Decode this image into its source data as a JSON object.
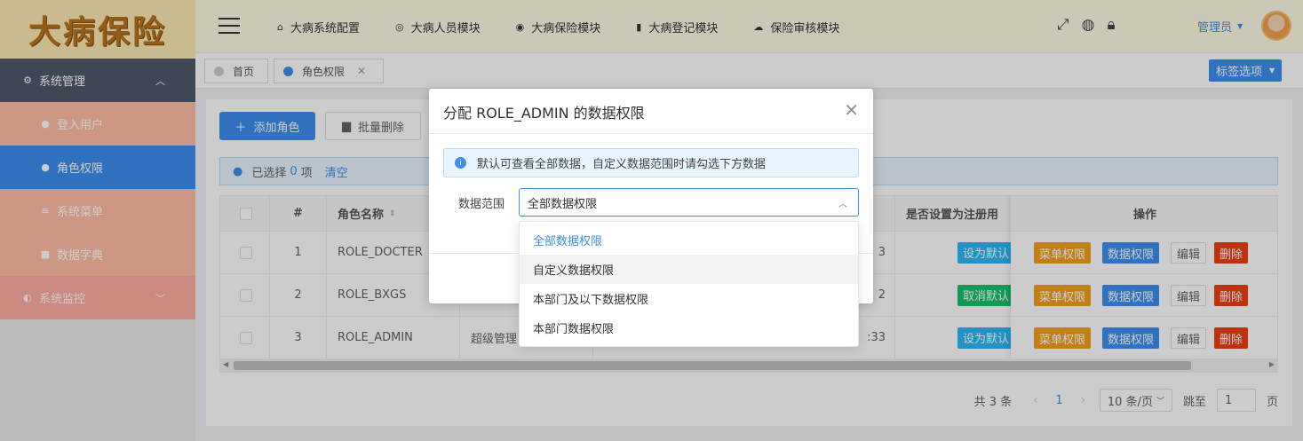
{
  "logo": {
    "text": "大病保险"
  },
  "sidebar": {
    "group": {
      "label": "系统管理",
      "icon": "gear-icon"
    },
    "items": [
      {
        "label": "登入用户",
        "icon": "user-icon"
      },
      {
        "label": "角色权限",
        "icon": "users-icon"
      },
      {
        "label": "系统菜单",
        "icon": "menu-icon"
      },
      {
        "label": "数据字典",
        "icon": "book-icon"
      }
    ],
    "monitor": {
      "label": "系统监控",
      "icon": "monitor-icon"
    }
  },
  "topnav": [
    {
      "label": "大病系统配置",
      "icon": "home-icon"
    },
    {
      "label": "大病人员模块",
      "icon": "settings-icon"
    },
    {
      "label": "大病保险模块",
      "icon": "disc-icon"
    },
    {
      "label": "大病登记模块",
      "icon": "book-icon"
    },
    {
      "label": "保险审核模块",
      "icon": "cloud-icon"
    }
  ],
  "user": {
    "name": "管理员"
  },
  "tags": {
    "home": "首页",
    "current": "角色权限",
    "options": "标签选项"
  },
  "toolbar": {
    "add": "添加角色",
    "batch_delete": "批量删除"
  },
  "selection": {
    "prefix": "已选择",
    "count": "0",
    "suffix": "项",
    "clear": "清空"
  },
  "table": {
    "headers": {
      "index": "#",
      "name": "角色名称",
      "register": "是否设置为注册用",
      "actions": "操作"
    },
    "rows": [
      {
        "index": "1",
        "name": "ROLE_DOCTER",
        "desc": "",
        "time": "3",
        "reg_btn": "设为默认",
        "reg_color": "#2db7f5"
      },
      {
        "index": "2",
        "name": "ROLE_BXGS",
        "desc": "",
        "time": "2",
        "reg_btn": "取消默认",
        "reg_color": "#19be6b"
      },
      {
        "index": "3",
        "name": "ROLE_ADMIN",
        "desc": "超级管理",
        "time": ":33",
        "reg_btn": "设为默认",
        "reg_color": "#2db7f5"
      }
    ],
    "actions": {
      "menu": "菜单权限",
      "data": "数据权限",
      "edit": "编辑",
      "delete": "删除"
    }
  },
  "pager": {
    "total": "共 3 条",
    "page": "1",
    "size": "10 条/页",
    "jump": "跳至",
    "jump_value": "1",
    "page_unit": "页"
  },
  "dialog": {
    "title": "分配 ROLE_ADMIN 的数据权限",
    "alert": "默认可查看全部数据，自定义数据范围时请勾选下方数据",
    "scope_label": "数据范围",
    "scope_value": "全部数据权限",
    "options": [
      "全部数据权限",
      "自定义数据权限",
      "本部门及以下数据权限",
      "本部门数据权限"
    ]
  },
  "colors": {
    "primary": "#3d8ff0",
    "warning": "#f0a020",
    "danger": "#ed4014",
    "success": "#19be6b",
    "info": "#2db7f5"
  }
}
